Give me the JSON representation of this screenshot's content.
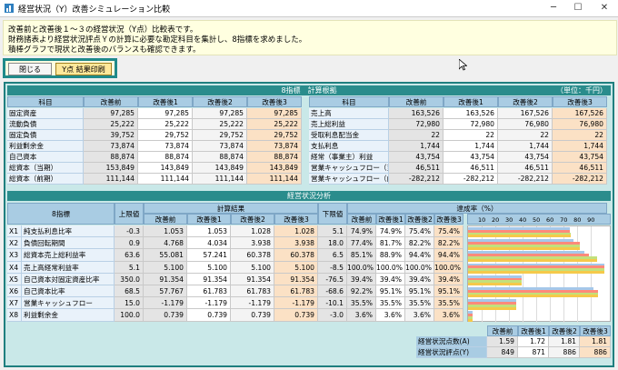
{
  "window": {
    "title": "経営状況（Y）改善シミュレーション比較",
    "minimize": "─",
    "maximize": "☐",
    "close": "✕"
  },
  "info": {
    "line1": "改善前と改善後１～３の経営状況（Y点）比較表です。",
    "line2": "財務諸表より経営状況評点Ｙの計算に必要な勘定科目を集計し、8指標を求めました。",
    "line3": "積棒グラフで現状と改善後のバランスも確認できます。"
  },
  "buttons": {
    "close": "閉じる",
    "print": "Y点 結果印刷"
  },
  "basis": {
    "title": "8指標　計算根拠",
    "unit": "（単位：千円）",
    "headers": [
      "科目",
      "改善前",
      "改善後1",
      "改善後2",
      "改善後3"
    ],
    "left_rows": [
      {
        "label": "固定資産",
        "v": [
          "97,285",
          "97,285",
          "97,285",
          "97,285"
        ]
      },
      {
        "label": "流動負債",
        "v": [
          "25,222",
          "25,222",
          "25,222",
          "25,222"
        ]
      },
      {
        "label": "固定負債",
        "v": [
          "39,752",
          "29,752",
          "29,752",
          "29,752"
        ]
      },
      {
        "label": "利益剰余金",
        "v": [
          "73,874",
          "73,874",
          "73,874",
          "73,874"
        ]
      },
      {
        "label": "自己資本",
        "v": [
          "88,874",
          "88,874",
          "88,874",
          "88,874"
        ]
      },
      {
        "label": "総資本（当期）",
        "v": [
          "153,849",
          "143,849",
          "143,849",
          "143,849"
        ]
      },
      {
        "label": "総資本（前期）",
        "v": [
          "111,144",
          "111,144",
          "111,144",
          "111,144"
        ]
      }
    ],
    "right_rows": [
      {
        "label": "売上高",
        "v": [
          "163,526",
          "163,526",
          "167,526",
          "167,526"
        ]
      },
      {
        "label": "売上総利益",
        "v": [
          "72,980",
          "72,980",
          "76,980",
          "76,980"
        ]
      },
      {
        "label": "受取利息配当金",
        "v": [
          "22",
          "22",
          "22",
          "22"
        ]
      },
      {
        "label": "支払利息",
        "v": [
          "1,744",
          "1,744",
          "1,744",
          "1,744"
        ]
      },
      {
        "label": "経常（事業主）利益",
        "v": [
          "43,754",
          "43,754",
          "43,754",
          "43,754"
        ]
      },
      {
        "label": "営業キャッシュフロー（当期）",
        "v": [
          "46,511",
          "46,511",
          "46,511",
          "46,511"
        ]
      },
      {
        "label": "営業キャッシュフロー（前期）",
        "v": [
          "-282,212",
          "-282,212",
          "-282,212",
          "-282,212"
        ]
      }
    ]
  },
  "analysis": {
    "title": "経営状況分析",
    "h_index": "8指標",
    "h_upper": "上限値",
    "h_calc": "計算結果",
    "h_lower": "下限値",
    "h_rate": "達成率（%）",
    "sub": [
      "改善前",
      "改善後1",
      "改善後2",
      "改善後3"
    ],
    "ticks": [
      "10",
      "20",
      "30",
      "40",
      "50",
      "60",
      "70",
      "80",
      "90"
    ],
    "rows": [
      {
        "code": "X1",
        "name": "純支払利息比率",
        "upper": "-0.3",
        "calc": [
          "1.053",
          "1.053",
          "1.028",
          "1.028"
        ],
        "lower": "5.1",
        "rate": [
          "74.9%",
          "74.9%",
          "75.4%",
          "75.4%"
        ]
      },
      {
        "code": "X2",
        "name": "負債回転期間",
        "upper": "0.9",
        "calc": [
          "4.768",
          "4.034",
          "3.938",
          "3.938"
        ],
        "lower": "18.0",
        "rate": [
          "77.4%",
          "81.7%",
          "82.2%",
          "82.2%"
        ]
      },
      {
        "code": "X3",
        "name": "総資本売上総利益率",
        "upper": "63.6",
        "calc": [
          "55.081",
          "57.241",
          "60.378",
          "60.378"
        ],
        "lower": "6.5",
        "rate": [
          "85.1%",
          "88.9%",
          "94.4%",
          "94.4%"
        ]
      },
      {
        "code": "X4",
        "name": "売上高経常利益率",
        "upper": "5.1",
        "calc": [
          "5.100",
          "5.100",
          "5.100",
          "5.100"
        ],
        "lower": "-8.5",
        "rate": [
          "100.0%",
          "100.0%",
          "100.0%",
          "100.0%"
        ]
      },
      {
        "code": "X5",
        "name": "自己資本対固定資産比率",
        "upper": "350.0",
        "calc": [
          "91.354",
          "91.354",
          "91.354",
          "91.354"
        ],
        "lower": "-76.5",
        "rate": [
          "39.4%",
          "39.4%",
          "39.4%",
          "39.4%"
        ]
      },
      {
        "code": "X6",
        "name": "自己資本比率",
        "upper": "68.5",
        "calc": [
          "57.767",
          "61.783",
          "61.783",
          "61.783"
        ],
        "lower": "-68.6",
        "rate": [
          "92.2%",
          "95.1%",
          "95.1%",
          "95.1%"
        ]
      },
      {
        "code": "X7",
        "name": "営業キャッシュフロー",
        "upper": "15.0",
        "calc": [
          "-1.179",
          "-1.179",
          "-1.179",
          "-1.179"
        ],
        "lower": "-10.1",
        "rate": [
          "35.5%",
          "35.5%",
          "35.5%",
          "35.5%"
        ]
      },
      {
        "code": "X8",
        "name": "利益剰余金",
        "upper": "100.0",
        "calc": [
          "0.739",
          "0.739",
          "0.739",
          "0.739"
        ],
        "lower": "-3.0",
        "rate": [
          "3.6%",
          "3.6%",
          "3.6%",
          "3.6%"
        ]
      }
    ],
    "rate_values": [
      [
        74.9,
        74.9,
        75.4,
        75.4
      ],
      [
        77.4,
        81.7,
        82.2,
        82.2
      ],
      [
        85.1,
        88.9,
        94.4,
        94.4
      ],
      [
        100.0,
        100.0,
        100.0,
        100.0
      ],
      [
        39.4,
        39.4,
        39.4,
        39.4
      ],
      [
        92.2,
        95.1,
        95.1,
        95.1
      ],
      [
        35.5,
        35.5,
        35.5,
        35.5
      ],
      [
        3.6,
        3.6,
        3.6,
        3.6
      ]
    ]
  },
  "summary": {
    "headers": [
      "改善前",
      "改善後1",
      "改善後2",
      "改善後3"
    ],
    "rows": [
      {
        "label": "経営状況点数(A)",
        "v": [
          "1.59",
          "1.72",
          "1.81",
          "1.81"
        ]
      },
      {
        "label": "経営状況評点(Y)",
        "v": [
          "849",
          "871",
          "886",
          "886"
        ]
      }
    ]
  },
  "colors": {
    "series": [
      "#a5c8ea",
      "#ff8a7a",
      "#c2e07c",
      "#f5c94a"
    ],
    "accent": "#2a8c8c"
  }
}
